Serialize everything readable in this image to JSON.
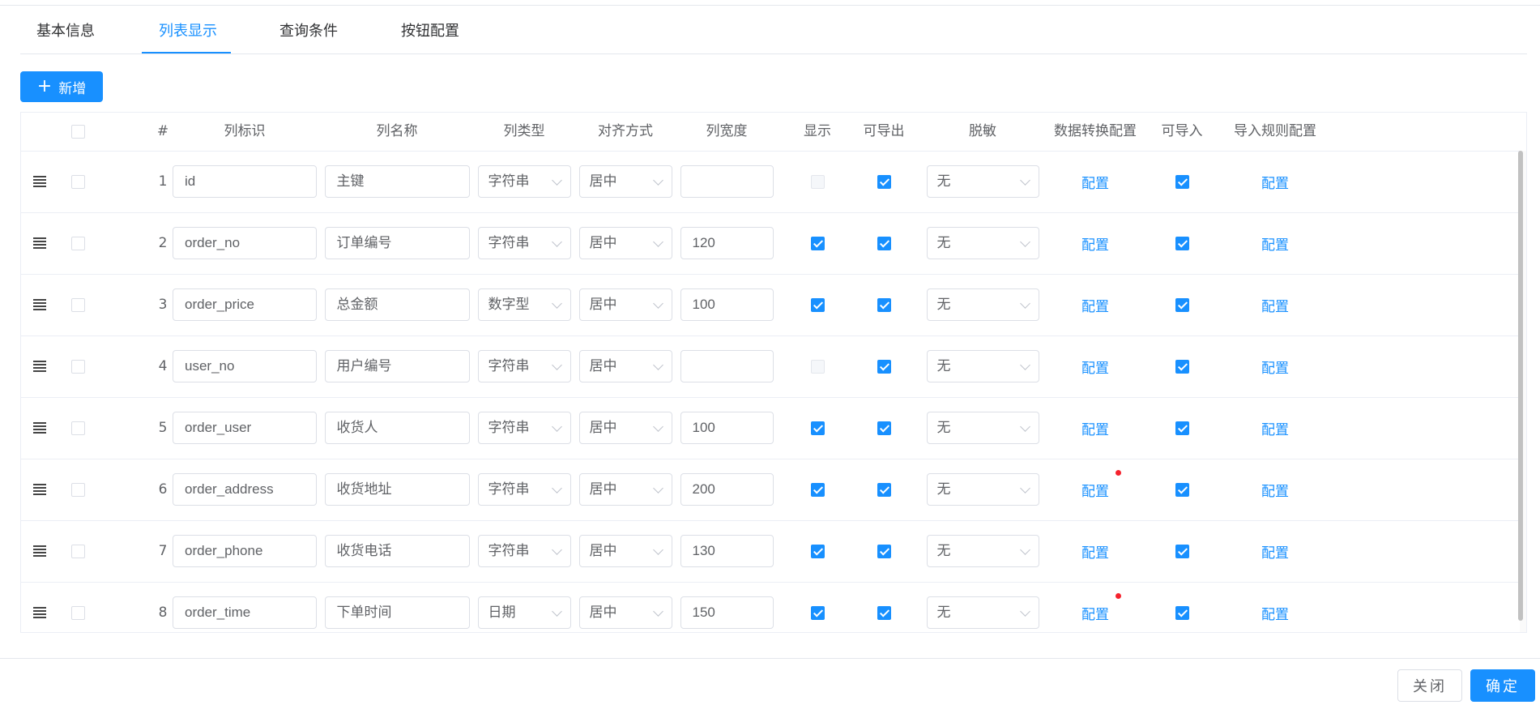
{
  "tabs": [
    {
      "label": "基本信息",
      "active": false
    },
    {
      "label": "列表显示",
      "active": true
    },
    {
      "label": "查询条件",
      "active": false
    },
    {
      "label": "按钮配置",
      "active": false
    }
  ],
  "toolbar": {
    "add_label": "新增",
    "add_icon": "plus-icon"
  },
  "table": {
    "headers": {
      "index": "#",
      "field": "列标识",
      "name": "列名称",
      "type": "列类型",
      "align": "对齐方式",
      "width": "列宽度",
      "show": "显示",
      "export": "可导出",
      "mask": "脱敏",
      "convert": "数据转换配置",
      "import": "可导入",
      "import_rule": "导入规则配置"
    },
    "rows": [
      {
        "index": "1",
        "field": "id",
        "name": "主键",
        "type": "字符串",
        "align": "居中",
        "width": "",
        "show": false,
        "show_disabled": true,
        "export": true,
        "mask": "无",
        "convert": "配置",
        "convert_dot": false,
        "import": true,
        "import_rule": "配置"
      },
      {
        "index": "2",
        "field": "order_no",
        "name": "订单编号",
        "type": "字符串",
        "align": "居中",
        "width": "120",
        "show": true,
        "show_disabled": false,
        "export": true,
        "mask": "无",
        "convert": "配置",
        "convert_dot": false,
        "import": true,
        "import_rule": "配置"
      },
      {
        "index": "3",
        "field": "order_price",
        "name": "总金额",
        "type": "数字型",
        "align": "居中",
        "width": "100",
        "show": true,
        "show_disabled": false,
        "export": true,
        "mask": "无",
        "convert": "配置",
        "convert_dot": false,
        "import": true,
        "import_rule": "配置"
      },
      {
        "index": "4",
        "field": "user_no",
        "name": "用户编号",
        "type": "字符串",
        "align": "居中",
        "width": "",
        "show": false,
        "show_disabled": true,
        "export": true,
        "mask": "无",
        "convert": "配置",
        "convert_dot": false,
        "import": true,
        "import_rule": "配置"
      },
      {
        "index": "5",
        "field": "order_user",
        "name": "收货人",
        "type": "字符串",
        "align": "居中",
        "width": "100",
        "show": true,
        "show_disabled": false,
        "export": true,
        "mask": "无",
        "convert": "配置",
        "convert_dot": false,
        "import": true,
        "import_rule": "配置"
      },
      {
        "index": "6",
        "field": "order_address",
        "name": "收货地址",
        "type": "字符串",
        "align": "居中",
        "width": "200",
        "show": true,
        "show_disabled": false,
        "export": true,
        "mask": "无",
        "convert": "配置",
        "convert_dot": true,
        "import": true,
        "import_rule": "配置"
      },
      {
        "index": "7",
        "field": "order_phone",
        "name": "收货电话",
        "type": "字符串",
        "align": "居中",
        "width": "130",
        "show": true,
        "show_disabled": false,
        "export": true,
        "mask": "无",
        "convert": "配置",
        "convert_dot": false,
        "import": true,
        "import_rule": "配置"
      },
      {
        "index": "8",
        "field": "order_time",
        "name": "下单时间",
        "type": "日期",
        "align": "居中",
        "width": "150",
        "show": true,
        "show_disabled": false,
        "export": true,
        "mask": "无",
        "convert": "配置",
        "convert_dot": true,
        "import": true,
        "import_rule": "配置"
      }
    ]
  },
  "footer": {
    "close_label": "关闭",
    "ok_label": "确定"
  },
  "colors": {
    "primary": "#1890ff",
    "dot": "#f5222d",
    "border": "#dcdfe6"
  }
}
